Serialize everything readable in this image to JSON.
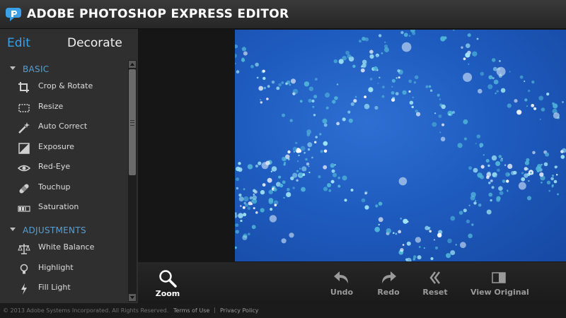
{
  "header": {
    "title": "ADOBE PHOTOSHOP EXPRESS EDITOR",
    "logo_icon": "photoshop-express-logo"
  },
  "mode_tabs": {
    "edit": "Edit",
    "decorate": "Decorate",
    "active": "Edit"
  },
  "sections": {
    "basic": {
      "label": "BASIC",
      "items": [
        {
          "label": "Crop & Rotate",
          "icon": "crop-icon"
        },
        {
          "label": "Resize",
          "icon": "resize-icon"
        },
        {
          "label": "Auto Correct",
          "icon": "magic-wand-icon"
        },
        {
          "label": "Exposure",
          "icon": "exposure-icon"
        },
        {
          "label": "Red-Eye",
          "icon": "eye-icon"
        },
        {
          "label": "Touchup",
          "icon": "bandage-icon"
        },
        {
          "label": "Saturation",
          "icon": "saturation-icon"
        }
      ]
    },
    "adjustments": {
      "label": "ADJUSTMENTS",
      "items": [
        {
          "label": "White Balance",
          "icon": "scales-icon"
        },
        {
          "label": "Highlight",
          "icon": "lightbulb-icon"
        },
        {
          "label": "Fill Light",
          "icon": "lightning-icon"
        }
      ]
    }
  },
  "toolbar": {
    "zoom": "Zoom",
    "undo": "Undo",
    "redo": "Redo",
    "reset": "Reset",
    "view_original": "View Original"
  },
  "footer": {
    "copyright": "© 2013 Adobe Systems Incorporated. All Rights Reserved.",
    "terms": "Terms of Use",
    "separator": "|",
    "privacy": "Privacy Policy"
  },
  "colors": {
    "accent": "#3aa1e6",
    "photo_blue": "#1f5cc0"
  }
}
